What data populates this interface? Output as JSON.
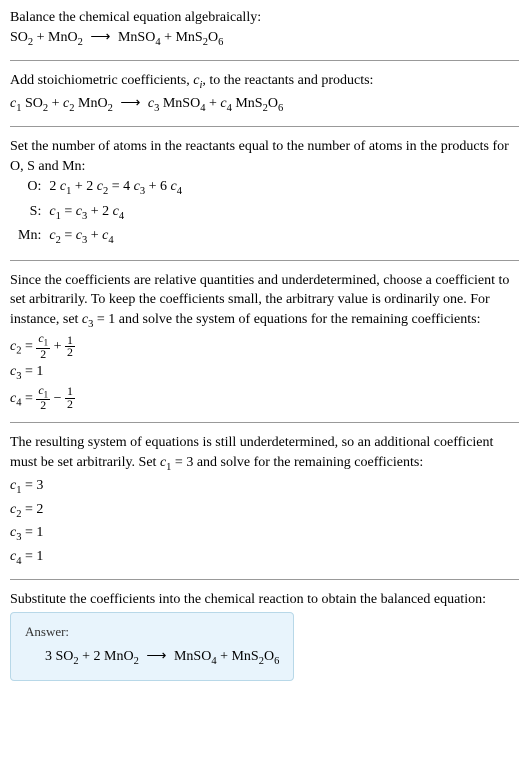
{
  "step1": {
    "text": "Balance the chemical equation algebraically:",
    "equation": "SO₂ + MnO₂ ⟶ MnSO₄ + MnS₂O₆"
  },
  "step2": {
    "text": "Add stoichiometric coefficients, cᵢ, to the reactants and products:",
    "equation": "c₁ SO₂ + c₂ MnO₂ ⟶ c₃ MnSO₄ + c₄ MnS₂O₆"
  },
  "step3": {
    "text": "Set the number of atoms in the reactants equal to the number of atoms in the products for O, S and Mn:",
    "rows": [
      {
        "label": "O:",
        "eq": "2 c₁ + 2 c₂ = 4 c₃ + 6 c₄"
      },
      {
        "label": "S:",
        "eq": "c₁ = c₃ + 2 c₄"
      },
      {
        "label": "Mn:",
        "eq": "c₂ = c₃ + c₄"
      }
    ]
  },
  "step4": {
    "text": "Since the coefficients are relative quantities and underdetermined, choose a coefficient to set arbitrarily. To keep the coefficients small, the arbitrary value is ordinarily one. For instance, set c₃ = 1 and solve the system of equations for the remaining coefficients:",
    "c2": {
      "lhs": "c₂ = ",
      "f1n": "c₁",
      "f1d": "2",
      "plus": " + ",
      "f2n": "1",
      "f2d": "2"
    },
    "c3": "c₃ = 1",
    "c4": {
      "lhs": "c₄ = ",
      "f1n": "c₁",
      "f1d": "2",
      "minus": " − ",
      "f2n": "1",
      "f2d": "2"
    }
  },
  "step5": {
    "text": "The resulting system of equations is still underdetermined, so an additional coefficient must be set arbitrarily. Set c₁ = 3 and solve for the remaining coefficients:",
    "lines": [
      "c₁ = 3",
      "c₂ = 2",
      "c₃ = 1",
      "c₄ = 1"
    ]
  },
  "step6": {
    "text": "Substitute the coefficients into the chemical reaction to obtain the balanced equation:"
  },
  "answer": {
    "label": "Answer:",
    "equation": "3 SO₂ + 2 MnO₂ ⟶ MnSO₄ + MnS₂O₆"
  }
}
